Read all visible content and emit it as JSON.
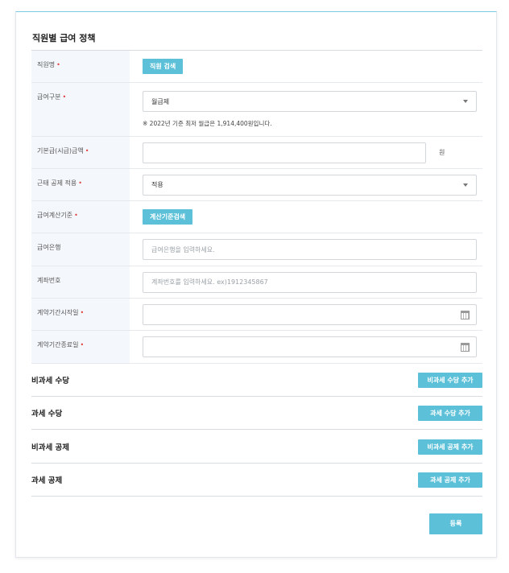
{
  "page": {
    "title": "직원별 급여 정책"
  },
  "form": {
    "employee": {
      "label": "직원명",
      "button": "직원 검색"
    },
    "pay_type": {
      "label": "급여구분",
      "value": "월급제",
      "note": "※ 2022년 기준 최저 월급은 1,914,400원입니다."
    },
    "base_pay": {
      "label": "기본급(시급)금액",
      "value": "",
      "unit": "원"
    },
    "attendance": {
      "label": "근태 공제 적용",
      "value": "적용"
    },
    "pay_basis": {
      "label": "급여계산기준",
      "button": "계산기준검색"
    },
    "bank": {
      "label": "급여은행",
      "placeholder": "급여은행을 입력하세요."
    },
    "account": {
      "label": "계좌번호",
      "placeholder": "계좌번호를 입력하세요. ex)1912345867"
    },
    "contract_start": {
      "label": "계약기간시작일",
      "value": ""
    },
    "contract_end": {
      "label": "계약기간종료일",
      "value": ""
    }
  },
  "sections": {
    "nontax_allowance": {
      "title": "비과세 수당",
      "button": "비과세 수당 추가"
    },
    "tax_allowance": {
      "title": "과세 수당",
      "button": "과세 수당 추가"
    },
    "nontax_deduction": {
      "title": "비과세 공제",
      "button": "비과세 공제 추가"
    },
    "tax_deduction": {
      "title": "과세 공제",
      "button": "과세 공제 추가"
    }
  },
  "actions": {
    "submit": "등록"
  },
  "colors": {
    "accent": "#5bc0d8",
    "required": "#e23c3c",
    "label_bg": "#f4f8fc"
  },
  "icons": {
    "select": "chevron-down-icon",
    "date": "calendar-icon"
  }
}
